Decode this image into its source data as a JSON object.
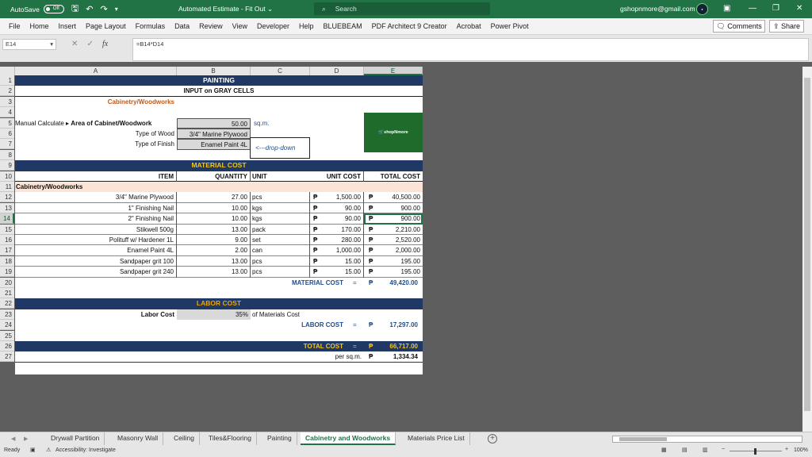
{
  "titlebar": {
    "autosave_label": "AutoSave",
    "autosave_state": "Off",
    "doc_title": "Automated Estimate - Fit Out",
    "search_placeholder": "Search",
    "user_email": "gshopnmore@gmail.com"
  },
  "menu": [
    "File",
    "Home",
    "Insert",
    "Page Layout",
    "Formulas",
    "Data",
    "Review",
    "View",
    "Developer",
    "Help",
    "BLUEBEAM",
    "PDF Architect 9 Creator",
    "Acrobat",
    "Power Pivot"
  ],
  "comments_label": "Comments",
  "share_label": "Share",
  "formula": {
    "name_box": "E14",
    "fx": "fx",
    "content": "=B14*D14"
  },
  "columns": [
    "A",
    "B",
    "C",
    "D",
    "E"
  ],
  "rows": [
    "1",
    "2",
    "3",
    "4",
    "5",
    "6",
    "7",
    "8",
    "9",
    "10",
    "11",
    "12",
    "13",
    "14",
    "15",
    "16",
    "17",
    "18",
    "19",
    "20",
    "21",
    "22",
    "23",
    "24",
    "25",
    "26",
    "27"
  ],
  "sheet": {
    "title": "PAINTING",
    "subtitle": "INPUT on GRAY CELLS",
    "section": "Cabinetry/Woodworks",
    "area_label_prefix": "Manual Calculate ▸",
    "area_label": "Area of Cabinet/Woodwork",
    "area_value": "50.00",
    "area_unit": "sq.m.",
    "wood_label": "Type of Wood",
    "wood_value": "3/4\" Marine Plywood",
    "finish_label": "Type of Finish",
    "finish_value": "Enamel Paint 4L",
    "dropdown_note": "<---drop-down",
    "logo_text": "shopNmore",
    "material_cost_title": "MATERIAL COST",
    "headers": {
      "item": "ITEM",
      "quantity": "QUANTITY",
      "unit": "UNIT",
      "unit_cost": "UNIT COST",
      "total_cost": "TOTAL COST"
    },
    "group_label": "Cabinetry/Woodworks",
    "currency": "₱",
    "items": [
      {
        "item": "3/4\" Marine Plywood",
        "qty": "27.00",
        "unit": "pcs",
        "unit_cost": "1,500.00",
        "total": "40,500.00"
      },
      {
        "item": "1\" Finishing Nail",
        "qty": "10.00",
        "unit": "kgs",
        "unit_cost": "90.00",
        "total": "900.00"
      },
      {
        "item": "2\" Finishing Nail",
        "qty": "10.00",
        "unit": "kgs",
        "unit_cost": "90.00",
        "total": "900.00"
      },
      {
        "item": "Stikwell 500g",
        "qty": "13.00",
        "unit": "pack",
        "unit_cost": "170.00",
        "total": "2,210.00"
      },
      {
        "item": "Polituff w/ Hardener 1L",
        "qty": "9.00",
        "unit": "set",
        "unit_cost": "280.00",
        "total": "2,520.00"
      },
      {
        "item": "Enamel Paint 4L",
        "qty": "2.00",
        "unit": "can",
        "unit_cost": "1,000.00",
        "total": "2,000.00"
      },
      {
        "item": "Sandpaper grit 100",
        "qty": "13.00",
        "unit": "pcs",
        "unit_cost": "15.00",
        "total": "195.00"
      },
      {
        "item": "Sandpaper grit 240",
        "qty": "13.00",
        "unit": "pcs",
        "unit_cost": "15.00",
        "total": "195.00"
      }
    ],
    "material_cost_label": "MATERIAL COST",
    "equals": "=",
    "material_cost_total": "49,420.00",
    "labor_cost_title": "LABOR COST",
    "labor_label": "Labor Cost",
    "labor_pct": "35%",
    "labor_pct_note": "of Materials Cost",
    "labor_cost_label": "LABOR COST",
    "labor_cost_total": "17,297.00",
    "total_cost_label": "TOTAL COST",
    "total_cost": "66,717.00",
    "per_sqm_label": "per sq.m.",
    "per_sqm": "1,334.34"
  },
  "sheet_tabs": [
    "Drywall Partition",
    "Masonry Wall",
    "Ceiling",
    "Tiles&Flooring",
    "Painting",
    "Cabinetry and Woodworks",
    "Materials Price List"
  ],
  "active_tab": "Cabinetry and Woodworks",
  "status": {
    "ready": "Ready",
    "accessibility": "Accessibility: Investigate",
    "zoom": "100%"
  },
  "colors": {
    "excel_green": "#217346",
    "navy_band": "#1f3864",
    "gold_text": "#f5c518",
    "input_gray": "#d9d9d9"
  }
}
